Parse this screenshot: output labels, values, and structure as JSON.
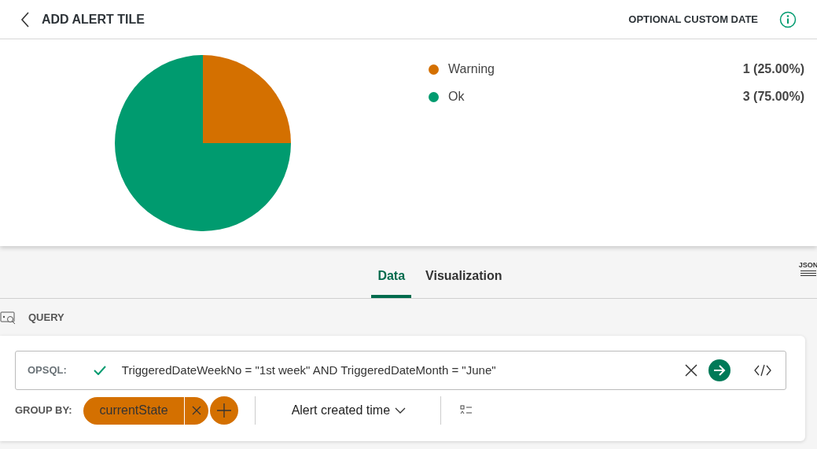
{
  "header": {
    "title": "ADD ALERT TILE",
    "action": "OPTIONAL CUSTOM DATE"
  },
  "chart": {
    "chart_data": {
      "type": "pie",
      "categories": [
        "Warning",
        "Ok"
      ],
      "values": [
        25,
        75
      ]
    },
    "legend": [
      {
        "reading": "1 (25.00%)",
        "color": "#d47000"
      },
      {
        "reading": "3 (75.00%)",
        "color": "#009b6f"
      }
    ]
  },
  "tabs": [
    {
      "label": "Data",
      "selected": true
    },
    {
      "label": "Visualization",
      "selected": false
    }
  ],
  "json_button": "JSON",
  "query": {
    "title": "QUERY",
    "language": "OPSQL:",
    "valid": true,
    "value": "TriggeredDateWeekNo = \"1st week\" AND TriggeredDateMonth = \"June\""
  },
  "group_by": {
    "label": "GROUP BY:",
    "chips": [
      "currentState"
    ],
    "time_field": "Alert created time"
  }
}
